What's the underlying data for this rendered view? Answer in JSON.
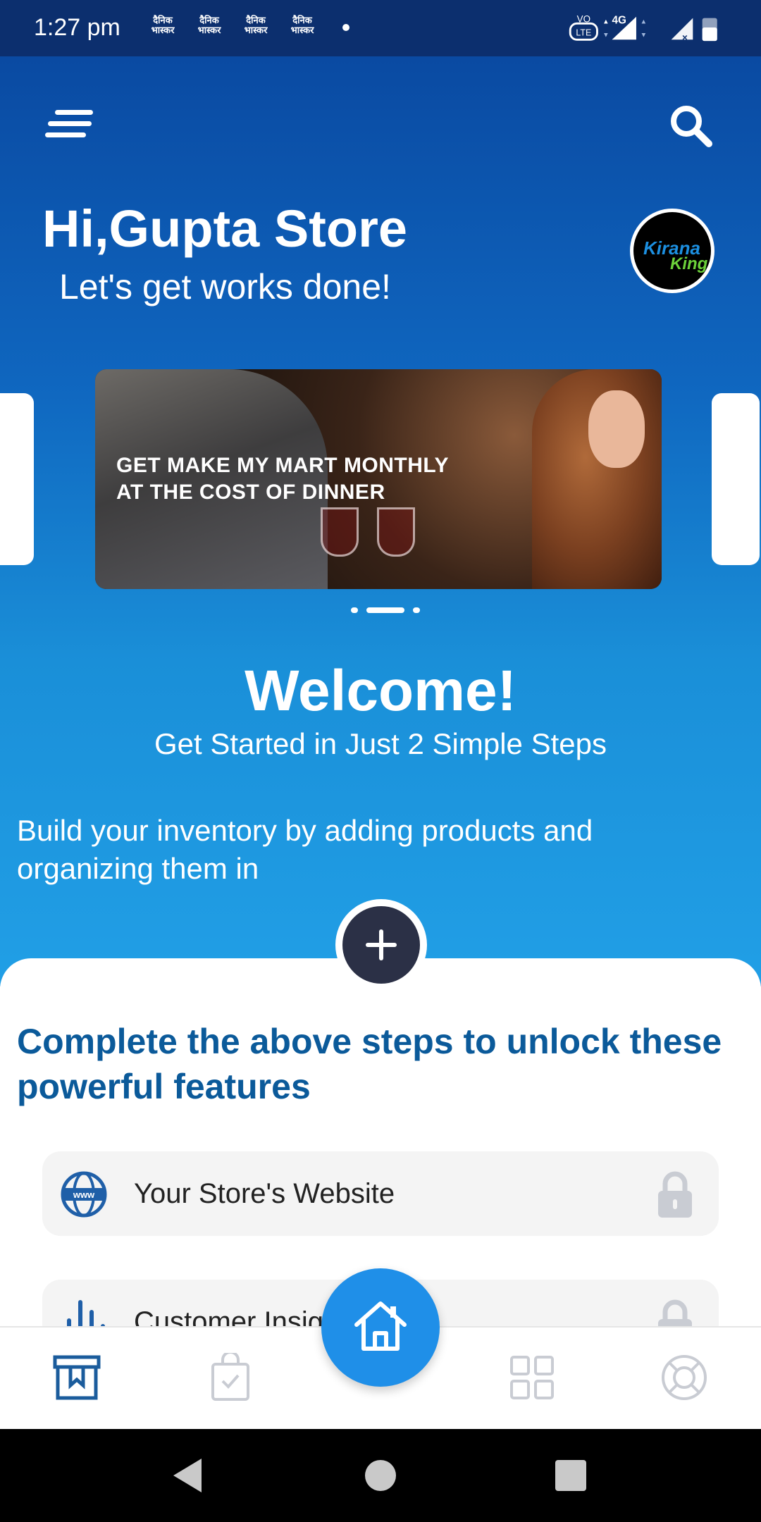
{
  "status_bar": {
    "time": "1:27 pm",
    "notification_label": "दैनिक भास्कर",
    "network": "4G",
    "volte": "VoLTE"
  },
  "header": {
    "greeting": "Hi,Gupta Store",
    "subtitle": "Let's get works done!",
    "logo_line1": "Kirana",
    "logo_line2": "King",
    "menu_icon": "menu-icon",
    "search_icon": "search-icon"
  },
  "banner": {
    "line1": "GET MAKE MY MART MONTHLY",
    "line2": "AT THE COST OF DINNER",
    "slides": 3,
    "active_slide": 2
  },
  "welcome": {
    "title": "Welcome!",
    "subtitle": "Get Started in Just 2 Simple Steps",
    "description": "Build your inventory by adding products and organizing them in"
  },
  "features": {
    "heading": "Complete the above steps to unlock  these powerful features",
    "items": [
      {
        "label": "Your Store's Website",
        "icon": "globe-www-icon",
        "locked": true
      },
      {
        "label": "Customer Insights",
        "icon": "bar-chart-icon",
        "locked": true
      }
    ]
  },
  "bottom_nav": {
    "items": [
      "catalog-icon",
      "orders-bag-icon",
      "home-icon",
      "grid-icon",
      "support-icon"
    ],
    "active": "home-icon"
  },
  "colors": {
    "primary_dark": "#0a4aa2",
    "primary_light": "#219fe6",
    "heading_blue": "#0b5a9a",
    "fab_blue": "#1f8fe8",
    "plus_dark": "#2b3046"
  }
}
